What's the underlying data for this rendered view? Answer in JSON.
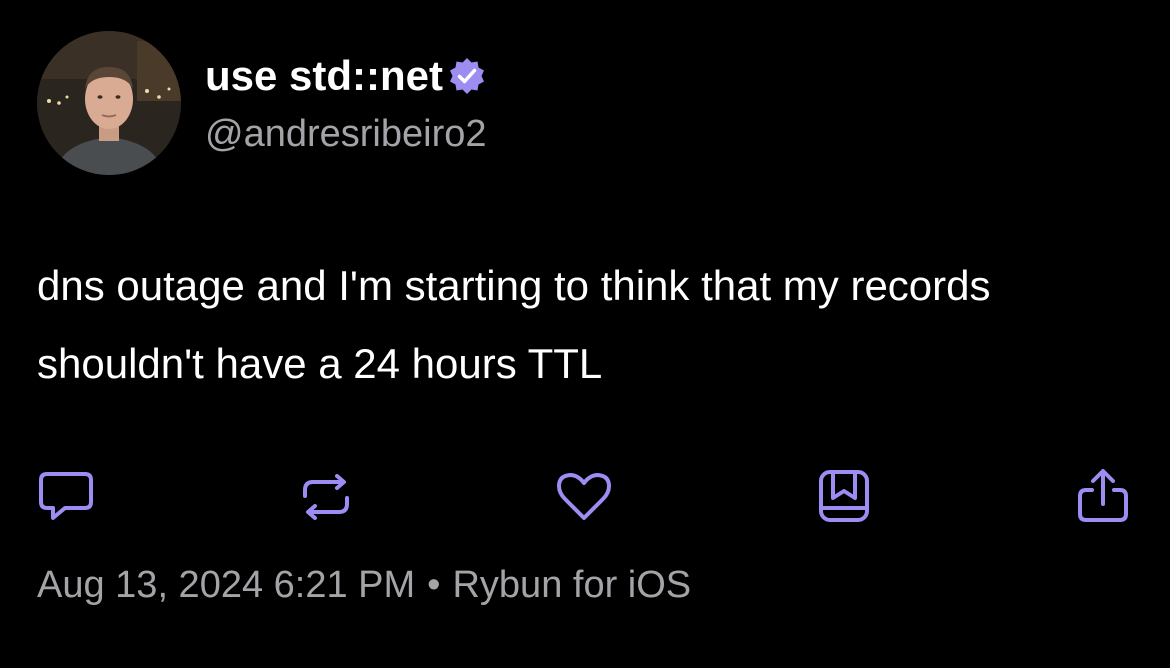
{
  "post": {
    "author": {
      "display_name": "use std::net",
      "handle": "@andresribeiro2",
      "verified": true,
      "avatar": "profile-photo"
    },
    "text": "dns outage and I'm starting to think that my records shouldn't have a 24 hours TTL",
    "timestamp": "Aug 13, 2024 6:21 PM",
    "separator": "•",
    "client": "Rybun for iOS"
  },
  "actions": [
    {
      "name": "reply",
      "icon": "speech-bubble-icon"
    },
    {
      "name": "repost",
      "icon": "repost-arrows-icon"
    },
    {
      "name": "like",
      "icon": "heart-icon"
    },
    {
      "name": "bookmark",
      "icon": "bookmark-icon"
    },
    {
      "name": "share",
      "icon": "share-upload-icon"
    }
  ],
  "colors": {
    "background": "#000000",
    "text_primary": "#ffffff",
    "text_secondary": "#a4a4a8",
    "accent": "#9d8cf2"
  }
}
